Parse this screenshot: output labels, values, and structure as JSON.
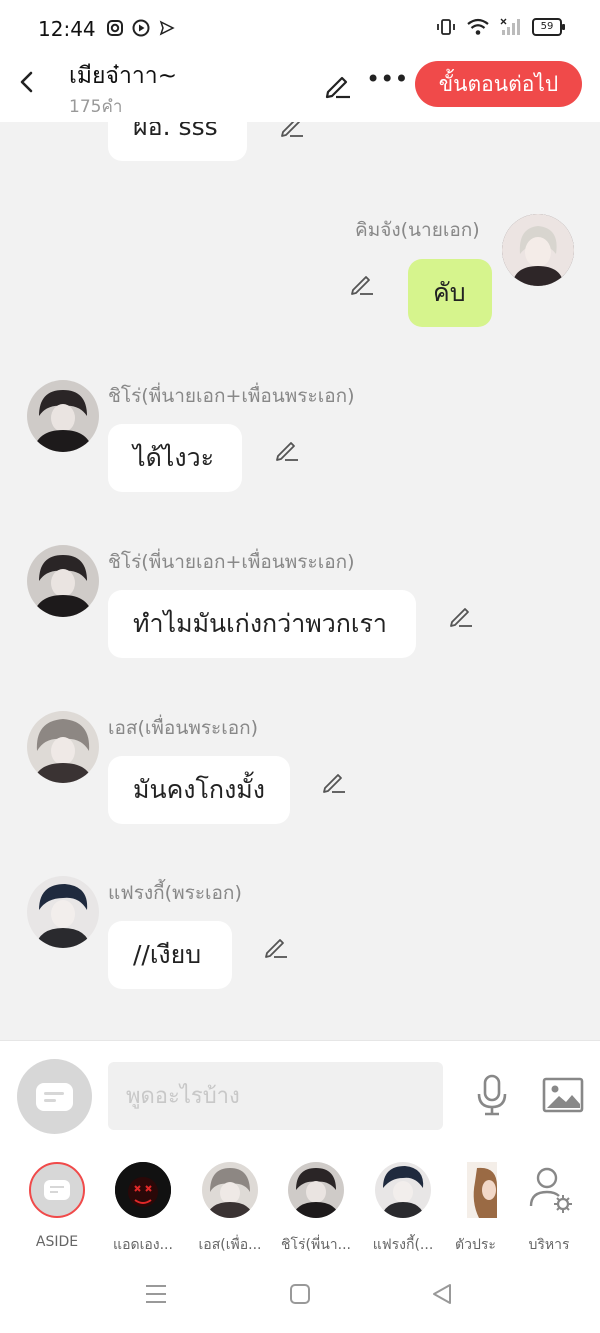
{
  "status_bar": {
    "time": "12:44",
    "battery": "59",
    "left_icons": [
      "instagram-icon",
      "play-icon",
      "send-icon"
    ],
    "right_icons": [
      "vibrate-icon",
      "wifi-icon",
      "signal-icon",
      "battery-icon"
    ]
  },
  "header": {
    "title": "เมียจ๋าาา~",
    "subtitle": "175คำ",
    "next_button": "ขั้นตอนต่อไป"
  },
  "messages": [
    {
      "sender": "",
      "text": "ผอ. sss",
      "side": "left"
    },
    {
      "sender": "คิมจัง(นายเอก)",
      "text": "คับ",
      "side": "right"
    },
    {
      "sender": "ชิโร่(พี่นายเอก+เพื่อนพระเอก)",
      "text": "ได้ไงวะ",
      "side": "left"
    },
    {
      "sender": "ชิโร่(พี่นายเอก+เพื่อนพระเอก)",
      "text": "ทำไมมันเก่งกว่าพวกเรา",
      "side": "left"
    },
    {
      "sender": "เอส(เพื่อนพระเอก)",
      "text": "มันคงโกงมั้ง",
      "side": "left"
    },
    {
      "sender": "แฟรงกี้(พระเอก)",
      "text": "//เงียบ",
      "side": "left"
    }
  ],
  "input": {
    "placeholder": "พูดอะไรบ้าง"
  },
  "characters": [
    {
      "label": "ASIDE"
    },
    {
      "label": "แอดเอง..."
    },
    {
      "label": "เอส(เพื่อ..."
    },
    {
      "label": "ชิโร่(พี่นา..."
    },
    {
      "label": "แฟรงกี้(..."
    },
    {
      "label": "ตัวประ"
    },
    {
      "label": "บริหาร"
    }
  ],
  "colors": {
    "accent": "#f04a4a",
    "my_bubble": "#d6f48d",
    "background": "#f2f2f2"
  }
}
